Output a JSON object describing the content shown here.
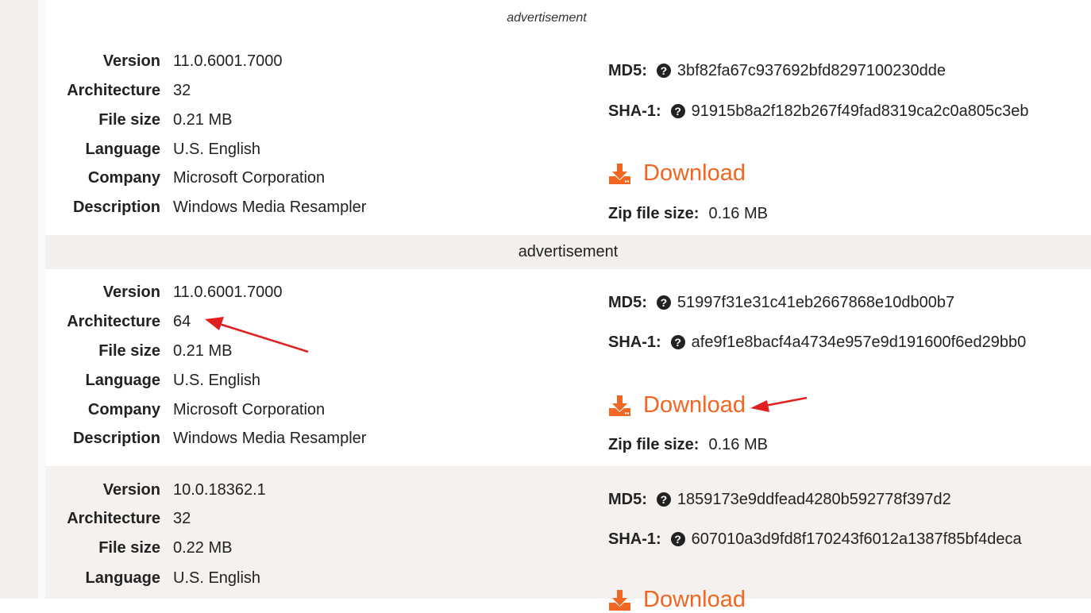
{
  "ad_top_label": "advertisement",
  "ad_bar_label": "advertisement",
  "labels": {
    "version": "Version",
    "architecture": "Architecture",
    "file_size": "File size",
    "language": "Language",
    "company": "Company",
    "description": "Description",
    "md5": "MD5:",
    "sha1": "SHA-1:",
    "download": "Download",
    "zip_size": "Zip file size:"
  },
  "entries": [
    {
      "version": "11.0.6001.7000",
      "architecture": "32",
      "file_size": "0.21 MB",
      "language": "U.S. English",
      "company": "Microsoft Corporation",
      "description": "Windows Media Resampler",
      "md5": "3bf82fa67c937692bfd8297100230dde",
      "sha1": "91915b8a2f182b267f49fad8319ca2c0a805c3eb",
      "zip_size": "0.16 MB"
    },
    {
      "version": "11.0.6001.7000",
      "architecture": "64",
      "file_size": "0.21 MB",
      "language": "U.S. English",
      "company": "Microsoft Corporation",
      "description": "Windows Media Resampler",
      "md5": "51997f31e31c41eb2667868e10db00b7",
      "sha1": "afe9f1e8bacf4a4734e957e9d191600f6ed29bb0",
      "zip_size": "0.16 MB"
    },
    {
      "version": "10.0.18362.1",
      "architecture": "32",
      "file_size": "0.22 MB",
      "language": "U.S. English",
      "md5": "1859173e9ddfead4280b592778f397d2",
      "sha1": "607010a3d9fd8f170243f6012a1387f85bf4deca"
    }
  ],
  "colors": {
    "accent": "#f26522",
    "annotation_arrow": "#e02020",
    "alt_row_bg": "#f4f1ee"
  },
  "icons": {
    "hash_help": "question-circle-icon",
    "download": "download-tray-icon"
  }
}
